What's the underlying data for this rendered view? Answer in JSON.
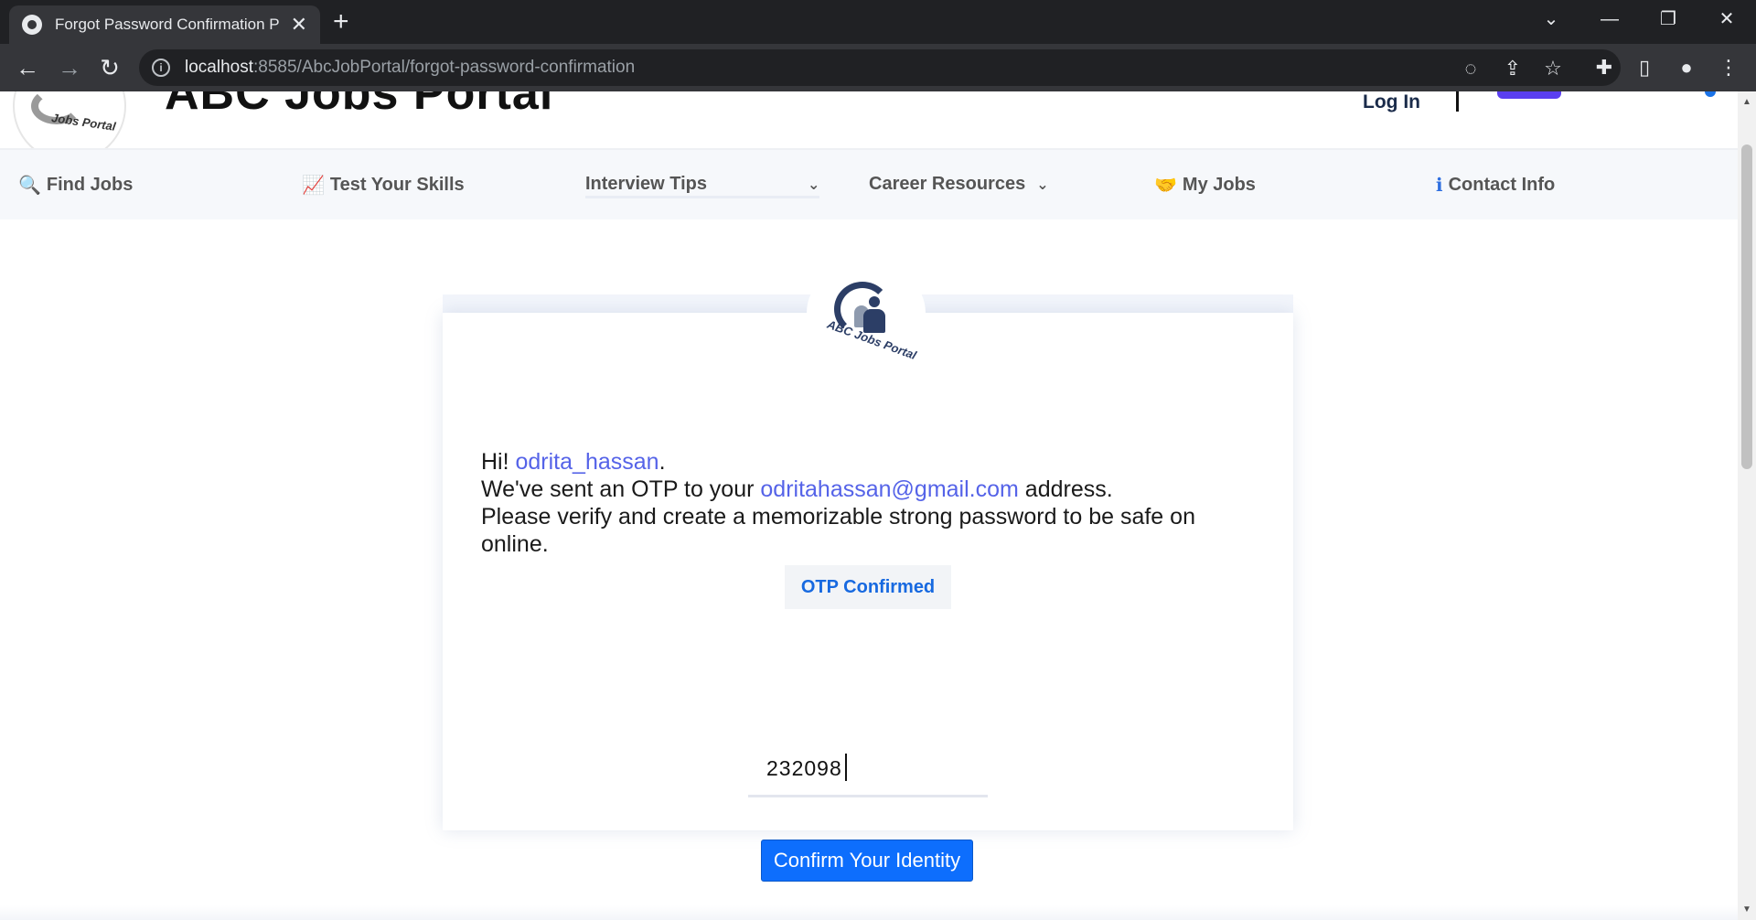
{
  "browser": {
    "tab_title": "Forgot Password Confirmation P",
    "tab_close": "✕",
    "new_tab": "+",
    "url_host": "localhost",
    "url_path": ":8585/AbcJobPortal/forgot-password-confirmation",
    "controls": {
      "tab_search": "⌄",
      "minimize": "—",
      "restore": "❐",
      "close": "✕"
    },
    "nav": {
      "back": "←",
      "forward": "→",
      "reload": "↻"
    },
    "omnibox_icons": {
      "eye_off": "◌",
      "share": "⇪",
      "star": "☆"
    },
    "toolbar_icons": {
      "extensions": "✚",
      "side_panel": "▯",
      "profile": "●",
      "menu": "⋮"
    }
  },
  "header": {
    "brand": "ABC Jobs Portal",
    "logo_text": "Jobs Portal",
    "login": "Log In"
  },
  "nav": {
    "items": [
      {
        "label": "Find Jobs",
        "icon": "🔍"
      },
      {
        "label": "Test Your Skills",
        "icon": "📈"
      },
      {
        "label": "Interview Tips",
        "chevron": "⌄"
      },
      {
        "label": "Career Resources",
        "chevron": "⌄"
      },
      {
        "label": "My Jobs",
        "icon": "🤝"
      },
      {
        "label": "Contact Info",
        "icon": "ℹ"
      }
    ]
  },
  "card": {
    "logo_text": "ABC Jobs Portal",
    "greeting_prefix": "Hi! ",
    "username": "odrita_hassan",
    "greeting_suffix": ".",
    "otp_prefix": "We've sent an OTP to your ",
    "email": "odritahassan@gmail.com",
    "otp_suffix": " address.",
    "instruction": "Please verify and create a memorizable strong password to be safe on online.",
    "otp_status": "OTP Confirmed",
    "otp_value": "232098",
    "confirm_button": "Confirm Your Identity"
  },
  "colors": {
    "accent_blue": "#0d6efd",
    "link_purple": "#5563e8",
    "nav_icon_blue": "#2f6fe0",
    "chrome_dark": "#202124"
  }
}
